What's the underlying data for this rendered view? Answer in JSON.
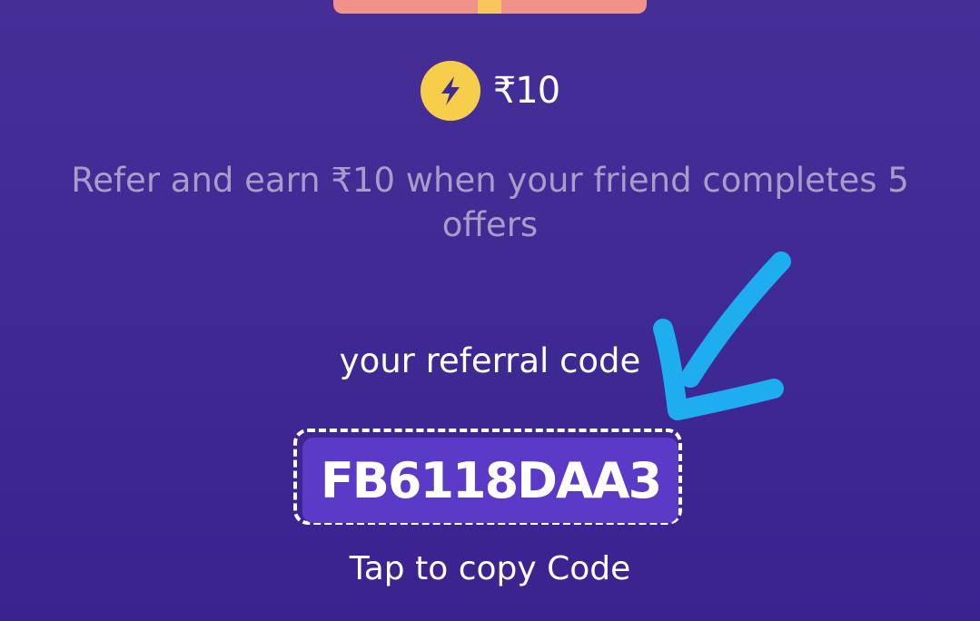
{
  "reward": {
    "amount": "₹10",
    "icon": "lightning-coin-icon"
  },
  "description": "Refer and earn ₹10 when your friend completes 5 offers",
  "referral": {
    "label": "your referral code",
    "code": "FB6118DAA3",
    "copy_hint": "Tap to copy Code"
  },
  "colors": {
    "background": "#3f2993",
    "coin": "#f7ce4b",
    "code_button": "#5a3ac6",
    "annotation_arrow": "#1eaef0"
  }
}
